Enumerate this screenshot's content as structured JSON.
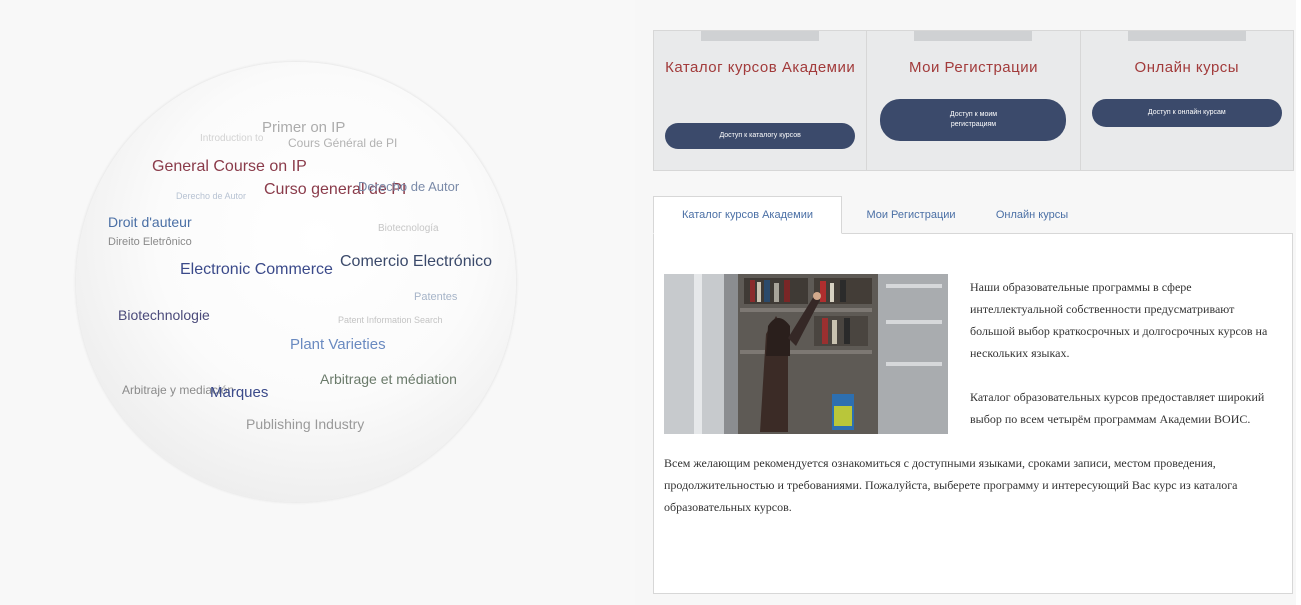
{
  "word_cloud": {
    "terms": [
      {
        "text": "Primer on IP",
        "color": "#8a8a8a"
      },
      {
        "text": "Introduction to",
        "color": "#b0b0b0"
      },
      {
        "text": "Cours Général de PI",
        "color": "#999999"
      },
      {
        "text": "General Course on IP",
        "color": "#8a3b4a"
      },
      {
        "text": "Curso general de PI",
        "color": "#8a3b4a"
      },
      {
        "text": "Derecho de Autor",
        "color": "#7a8aa8"
      },
      {
        "text": "Derecho de Autor",
        "color": "#a6b4c8"
      },
      {
        "text": "Droit d'auteur",
        "color": "#4a6fa5"
      },
      {
        "text": "Biotecnología",
        "color": "#b8b8b8"
      },
      {
        "text": "Direito Eletrônico",
        "color": "#8a8a8a"
      },
      {
        "text": "Electronic Commerce",
        "color": "#3b4a8a"
      },
      {
        "text": "Comercio Electrónico",
        "color": "#3b4a6b"
      },
      {
        "text": "Patentes",
        "color": "#a6b4c8"
      },
      {
        "text": "Biotechnologie",
        "color": "#4a4a7a"
      },
      {
        "text": "Patent Information Search",
        "color": "#c4c4c4"
      },
      {
        "text": "Plant Varieties",
        "color": "#6a8ac0"
      },
      {
        "text": "Arbitrage et médiation",
        "color": "#6a7a6a"
      },
      {
        "text": "Arbitraje y mediación",
        "color": "#8a8a8a"
      },
      {
        "text": "Marques",
        "color": "#3b4a8a"
      },
      {
        "text": "Publishing Industry",
        "color": "#9a9a9a"
      }
    ]
  },
  "panels": [
    {
      "title": "Каталог курсов Академии",
      "button": "Доступ к каталогу курсов"
    },
    {
      "title": "Мои Регистрации",
      "button": "Доступ к моим регистрациям"
    },
    {
      "title": "Онлайн курсы",
      "button": "Доступ к онлайн курсам"
    }
  ],
  "tabs": [
    {
      "label": "Каталог курсов Академии",
      "active": true
    },
    {
      "label": "Мои Регистрации",
      "active": false
    },
    {
      "label": "Онлайн курсы",
      "active": false
    }
  ],
  "content": {
    "paragraph_1": "Наши образовательные программы в сфере интеллектуальной собственности предусматривают большой выбор краткосрочных и долгосрочных курсов на нескольких языках.",
    "paragraph_2": "Каталог образовательных курсов предоставляет широкий выбор по всем четырём программам Академии ВОИС.",
    "paragraph_3": "Всем желающим рекомендуется ознакомиться с доступными языками, сроками записи, местом проведения, продолжительностью и требованиями. Пожалуйста, выберете программу и интересующий Вас курс из каталога образовательных курсов."
  },
  "colors": {
    "accent_red": "#a23b3b",
    "button_navy": "#3b4a6b",
    "tab_link": "#4a6fa5"
  }
}
